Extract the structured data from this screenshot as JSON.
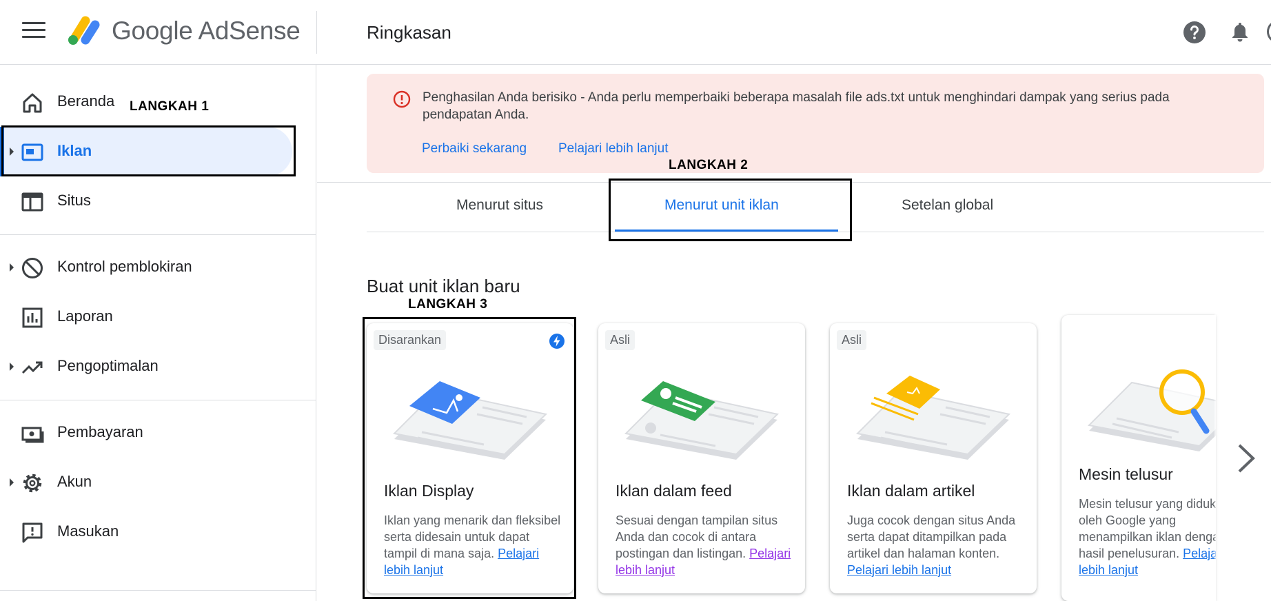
{
  "header": {
    "brand": "Google AdSense",
    "page_title": "Ringkasan"
  },
  "sidebar": {
    "items": [
      {
        "label": "Beranda",
        "icon": "home-icon"
      },
      {
        "label": "Iklan",
        "icon": "ads-icon",
        "active": true
      },
      {
        "label": "Situs",
        "icon": "sites-icon"
      },
      {
        "label": "Kontrol pemblokiran",
        "icon": "block-icon"
      },
      {
        "label": "Laporan",
        "icon": "report-icon"
      },
      {
        "label": "Pengoptimalan",
        "icon": "trend-icon"
      },
      {
        "label": "Pembayaran",
        "icon": "payment-icon"
      },
      {
        "label": "Akun",
        "icon": "gear-icon"
      },
      {
        "label": "Masukan",
        "icon": "feedback-icon"
      }
    ]
  },
  "annotations": {
    "step1": "LANGKAH 1",
    "step2": "LANGKAH 2",
    "step3": "LANGKAH 3"
  },
  "alert": {
    "message": "Penghasilan Anda berisiko - Anda perlu memperbaiki beberapa masalah file ads.txt untuk menghindari dampak yang serius pada pendapatan Anda.",
    "fix_link": "Perbaiki sekarang",
    "learn_link": "Pelajari lebih lanjut"
  },
  "tabs": [
    {
      "label": "Menurut situs"
    },
    {
      "label": "Menurut unit iklan",
      "active": true
    },
    {
      "label": "Setelan global"
    }
  ],
  "section": {
    "title": "Buat unit iklan baru"
  },
  "cards": [
    {
      "chip": "Disarankan",
      "title": "Iklan Display",
      "desc": "Iklan yang menarik dan fleksibel serta didesain untuk dapat tampil di mana saja.",
      "link": "Pelajari lebih lanjut",
      "accent": "#4285f4"
    },
    {
      "chip": "Asli",
      "title": "Iklan dalam feed",
      "desc": "Sesuai dengan tampilan situs Anda dan cocok di antara postingan dan listingan.",
      "link": "Pelajari lebih lanjut",
      "accent": "#34a853"
    },
    {
      "chip": "Asli",
      "title": "Iklan dalam artikel",
      "desc": "Juga cocok dengan situs Anda serta dapat ditampilkan pada artikel dan halaman konten.",
      "link": "Pelajari lebih lanjut",
      "accent": "#fbbc04"
    },
    {
      "chip": "",
      "title": "Mesin telusur",
      "desc": "Mesin telusur yang didukung oleh Google yang menampilkan iklan dengan hasil penelusuran.",
      "link": "Pelajari lebih lanjut",
      "accent": "#fbbc04"
    }
  ],
  "colors": {
    "accent": "#1a73e8",
    "alert_bg": "#fce8e6",
    "alert_icon": "#d93025",
    "active_nav_bg": "#e8f0fe"
  }
}
